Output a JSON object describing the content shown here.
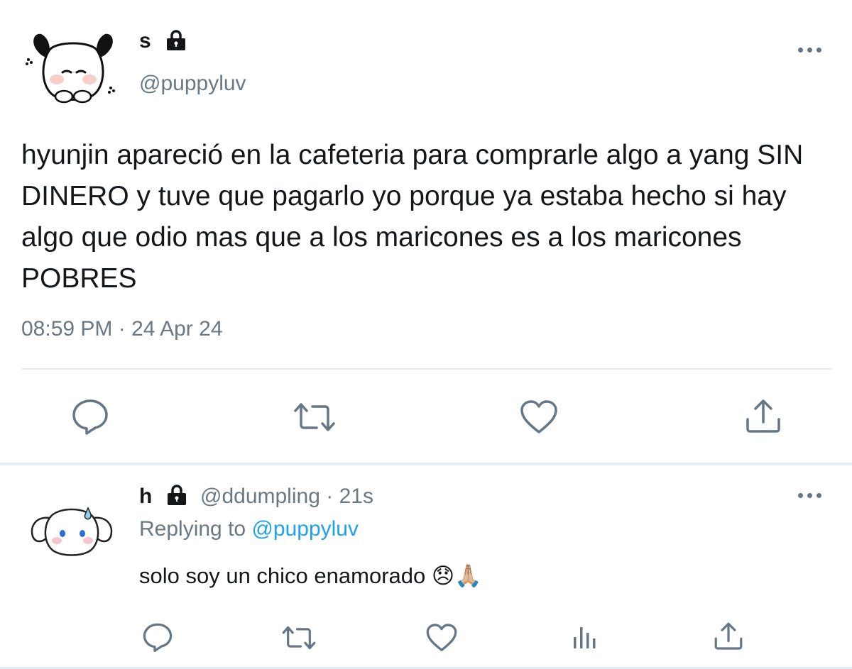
{
  "main_tweet": {
    "display_name": "s",
    "handle": "@puppyluv",
    "text": "hyunjin apareció en la cafeteria para comprarle algo a yang SIN DINERO y tuve que pagarlo yo porque ya estaba hecho si hay algo que odio mas que a los maricones es a los maricones POBRES",
    "timestamp": "08:59 PM · 24 Apr 24",
    "actions": [
      "reply-icon",
      "retweet-icon",
      "like-icon",
      "share-icon"
    ]
  },
  "reply_tweet": {
    "display_name": "h",
    "handle": "@ddumpling",
    "separator": "·",
    "time_ago": "21s",
    "replying_prefix": "Replying to",
    "replying_handle": "@puppyluv",
    "text": "solo soy un chico enamorado",
    "emojis": [
      "😞",
      "🙏🏼"
    ],
    "actions": [
      "reply-icon",
      "retweet-icon",
      "like-icon",
      "analytics-icon",
      "share-icon"
    ]
  },
  "colors": {
    "text": "#14171a",
    "muted": "#697882",
    "link": "#1da1f2",
    "icon": "#657786",
    "divider": "#e6ecf0"
  }
}
